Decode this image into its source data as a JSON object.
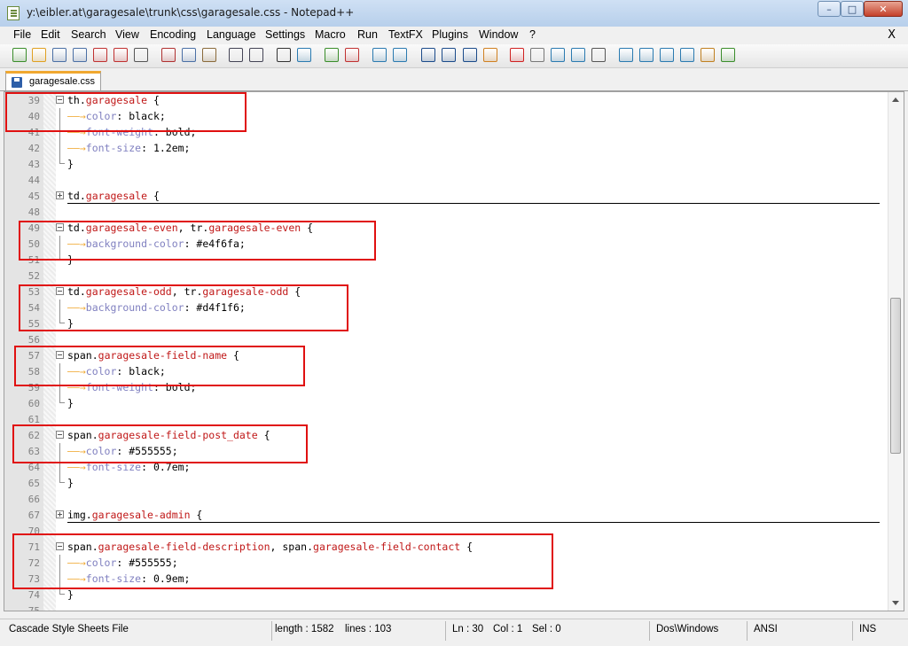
{
  "window": {
    "title": "y:\\eibler.at\\garagesale\\trunk\\css\\garagesale.css - Notepad++",
    "minimize": "–",
    "maximize": "□",
    "close": "✕"
  },
  "menu": {
    "items": [
      "File",
      "Edit",
      "Search",
      "View",
      "Encoding",
      "Language",
      "Settings",
      "Macro",
      "Run",
      "TextFX",
      "Plugins",
      "Window",
      "?"
    ],
    "close_doc": "X"
  },
  "toolbar": {
    "icons": [
      "new-file-icon",
      "open-file-icon",
      "save-icon",
      "save-all-icon",
      "close-icon",
      "close-all-icon",
      "print-icon",
      "cut-icon",
      "copy-icon",
      "paste-icon",
      "undo-icon",
      "redo-icon",
      "find-icon",
      "replace-icon",
      "zoom-in-icon",
      "zoom-out-icon",
      "sync-vertical-icon",
      "sync-horizontal-icon",
      "word-wrap-icon",
      "show-all-chars-icon",
      "indent-guide-icon",
      "user-lang-icon",
      "record-macro-icon",
      "stop-record-icon",
      "play-macro-icon",
      "play-multiple-icon",
      "save-macro-icon",
      "trim-icon",
      "move-up-icon",
      "move-down-icon",
      "convert-icon",
      "block-icon",
      "spell-check-icon"
    ]
  },
  "tab": {
    "label": "garagesale.css"
  },
  "editor": {
    "lines": [
      {
        "num": "39",
        "fold": "open",
        "parts": [
          [
            "sel",
            "th"
          ],
          [
            "",
            "."
          ],
          [
            "cls",
            "garagesale"
          ],
          [
            "",
            " {"
          ]
        ]
      },
      {
        "num": "40",
        "fold": "line",
        "parts": [
          [
            "arrow",
            "——→"
          ],
          [
            "prop",
            "color"
          ],
          [
            "",
            ": black;"
          ]
        ]
      },
      {
        "num": "41",
        "fold": "line",
        "parts": [
          [
            "arrow",
            "——→"
          ],
          [
            "prop",
            "font-weight"
          ],
          [
            "",
            ": bold;"
          ]
        ]
      },
      {
        "num": "42",
        "fold": "line",
        "parts": [
          [
            "arrow",
            "——→"
          ],
          [
            "prop",
            "font-size"
          ],
          [
            "",
            ": 1.2em;"
          ]
        ]
      },
      {
        "num": "43",
        "fold": "end",
        "parts": [
          [
            "",
            "}"
          ]
        ]
      },
      {
        "num": "44",
        "fold": "none",
        "parts": []
      },
      {
        "num": "45",
        "fold": "closed",
        "parts": [
          [
            "sel",
            "td"
          ],
          [
            "",
            "."
          ],
          [
            "cls",
            "garagesale"
          ],
          [
            "",
            " {"
          ]
        ]
      },
      {
        "num": "48",
        "fold": "none",
        "parts": []
      },
      {
        "num": "49",
        "fold": "open",
        "parts": [
          [
            "sel",
            "td"
          ],
          [
            "",
            "."
          ],
          [
            "cls",
            "garagesale-even"
          ],
          [
            "",
            ", "
          ],
          [
            "sel",
            "tr"
          ],
          [
            "",
            "."
          ],
          [
            "cls",
            "garagesale-even"
          ],
          [
            "",
            " {"
          ]
        ]
      },
      {
        "num": "50",
        "fold": "line",
        "parts": [
          [
            "arrow",
            "——→"
          ],
          [
            "prop",
            "background-color"
          ],
          [
            "",
            ": #e4f6fa;"
          ]
        ]
      },
      {
        "num": "51",
        "fold": "end",
        "parts": [
          [
            "",
            "}"
          ]
        ]
      },
      {
        "num": "52",
        "fold": "none",
        "parts": []
      },
      {
        "num": "53",
        "fold": "open",
        "parts": [
          [
            "sel",
            "td"
          ],
          [
            "",
            "."
          ],
          [
            "cls",
            "garagesale-odd"
          ],
          [
            "",
            ", "
          ],
          [
            "sel",
            "tr"
          ],
          [
            "",
            "."
          ],
          [
            "cls",
            "garagesale-odd"
          ],
          [
            "",
            " {"
          ]
        ]
      },
      {
        "num": "54",
        "fold": "line",
        "parts": [
          [
            "arrow",
            "——→"
          ],
          [
            "prop",
            "background-color"
          ],
          [
            "",
            ": #d4f1f6;"
          ]
        ]
      },
      {
        "num": "55",
        "fold": "end",
        "parts": [
          [
            "",
            "}"
          ]
        ]
      },
      {
        "num": "56",
        "fold": "none",
        "parts": []
      },
      {
        "num": "57",
        "fold": "open",
        "parts": [
          [
            "sel",
            "span"
          ],
          [
            "",
            "."
          ],
          [
            "cls",
            "garagesale-field-name"
          ],
          [
            "",
            " {"
          ]
        ]
      },
      {
        "num": "58",
        "fold": "line",
        "parts": [
          [
            "arrow",
            "——→"
          ],
          [
            "prop",
            "color"
          ],
          [
            "",
            ": black;"
          ]
        ]
      },
      {
        "num": "59",
        "fold": "line",
        "parts": [
          [
            "arrow",
            "——→"
          ],
          [
            "prop",
            "font-weight"
          ],
          [
            "",
            ": bold;"
          ]
        ]
      },
      {
        "num": "60",
        "fold": "end",
        "parts": [
          [
            "",
            "}"
          ]
        ]
      },
      {
        "num": "61",
        "fold": "none",
        "parts": []
      },
      {
        "num": "62",
        "fold": "open",
        "parts": [
          [
            "sel",
            "span"
          ],
          [
            "",
            "."
          ],
          [
            "cls",
            "garagesale-field-post_date"
          ],
          [
            "",
            " {"
          ]
        ]
      },
      {
        "num": "63",
        "fold": "line",
        "parts": [
          [
            "arrow",
            "——→"
          ],
          [
            "prop",
            "color"
          ],
          [
            "",
            ": #555555;"
          ]
        ]
      },
      {
        "num": "64",
        "fold": "line",
        "parts": [
          [
            "arrow",
            "——→"
          ],
          [
            "prop",
            "font-size"
          ],
          [
            "",
            ": 0.7em;"
          ]
        ]
      },
      {
        "num": "65",
        "fold": "end",
        "parts": [
          [
            "",
            "}"
          ]
        ]
      },
      {
        "num": "66",
        "fold": "none",
        "parts": []
      },
      {
        "num": "67",
        "fold": "closed",
        "parts": [
          [
            "sel",
            "img"
          ],
          [
            "",
            "."
          ],
          [
            "cls",
            "garagesale-admin"
          ],
          [
            "",
            " {"
          ]
        ]
      },
      {
        "num": "70",
        "fold": "none",
        "parts": []
      },
      {
        "num": "71",
        "fold": "open",
        "parts": [
          [
            "sel",
            "span"
          ],
          [
            "",
            "."
          ],
          [
            "cls",
            "garagesale-field-description"
          ],
          [
            "",
            ", "
          ],
          [
            "sel",
            "span"
          ],
          [
            "",
            "."
          ],
          [
            "cls",
            "garagesale-field-contact"
          ],
          [
            "",
            " {"
          ]
        ]
      },
      {
        "num": "72",
        "fold": "line",
        "parts": [
          [
            "arrow",
            "——→"
          ],
          [
            "prop",
            "color"
          ],
          [
            "",
            ": #555555;"
          ]
        ]
      },
      {
        "num": "73",
        "fold": "line",
        "parts": [
          [
            "arrow",
            "——→"
          ],
          [
            "prop",
            "font-size"
          ],
          [
            "",
            ": 0.9em;"
          ]
        ]
      },
      {
        "num": "74",
        "fold": "end",
        "parts": [
          [
            "",
            "}"
          ]
        ]
      },
      {
        "num": "75",
        "fold": "none",
        "parts": []
      }
    ]
  },
  "status": {
    "file_type": "Cascade Style Sheets File",
    "length": "length : 1582",
    "lines": "lines : 103",
    "ln": "Ln : 30",
    "col": "Col : 1",
    "sel": "Sel : 0",
    "eol": "Dos\\Windows",
    "encoding": "ANSI",
    "mode": "INS"
  }
}
